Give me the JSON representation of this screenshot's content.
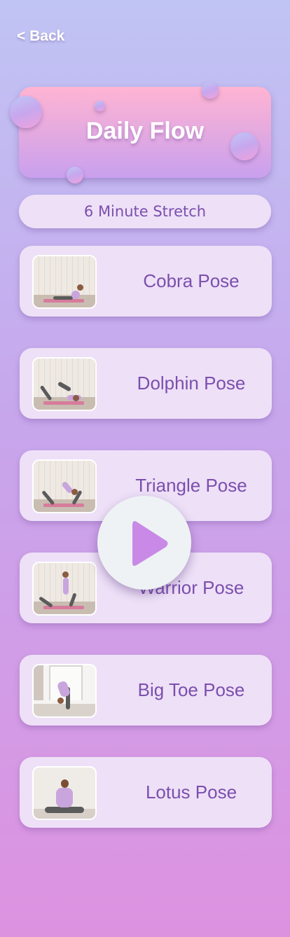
{
  "nav": {
    "back_label": "< Back"
  },
  "hero": {
    "title": "Daily Flow"
  },
  "session": {
    "label": "6 Minute Stretch"
  },
  "poses": [
    {
      "label": "Cobra Pose",
      "thumb_icon": "cobra-pose-thumbnail"
    },
    {
      "label": "Dolphin Pose",
      "thumb_icon": "dolphin-pose-thumbnail"
    },
    {
      "label": "Triangle Pose",
      "thumb_icon": "triangle-pose-thumbnail"
    },
    {
      "label": "Warrior Pose",
      "thumb_icon": "warrior-pose-thumbnail"
    },
    {
      "label": "Big Toe Pose",
      "thumb_icon": "big-toe-pose-thumbnail"
    },
    {
      "label": "Lotus Pose",
      "thumb_icon": "lotus-pose-thumbnail"
    }
  ],
  "play": {
    "icon": "play-icon"
  },
  "colors": {
    "accent_text": "#7b4fad",
    "card_bg": "#eee0f7",
    "hero_top": "#ffb4d2",
    "hero_bottom": "#c9a0ee",
    "play_triangle": "#c88ae6"
  }
}
